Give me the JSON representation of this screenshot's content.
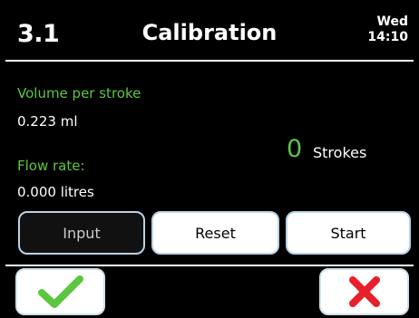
{
  "header": {
    "screen_number": "3.1",
    "title": "Calibration",
    "day": "Wed",
    "time": "14:10"
  },
  "fields": {
    "volume_label": "Volume per stroke",
    "volume_value": "0.223 ml",
    "flow_label": "Flow rate:",
    "flow_value": "0.000 litres"
  },
  "strokes": {
    "count": "0",
    "unit": "Strokes"
  },
  "buttons": {
    "input_label": "Input",
    "reset_label": "Reset",
    "start_label": "Start"
  },
  "footer": {
    "confirm_icon": "check-icon",
    "cancel_icon": "close-icon"
  },
  "colors": {
    "accent_green": "#5cc641",
    "cancel_red": "#e8202a",
    "background": "#000000"
  }
}
